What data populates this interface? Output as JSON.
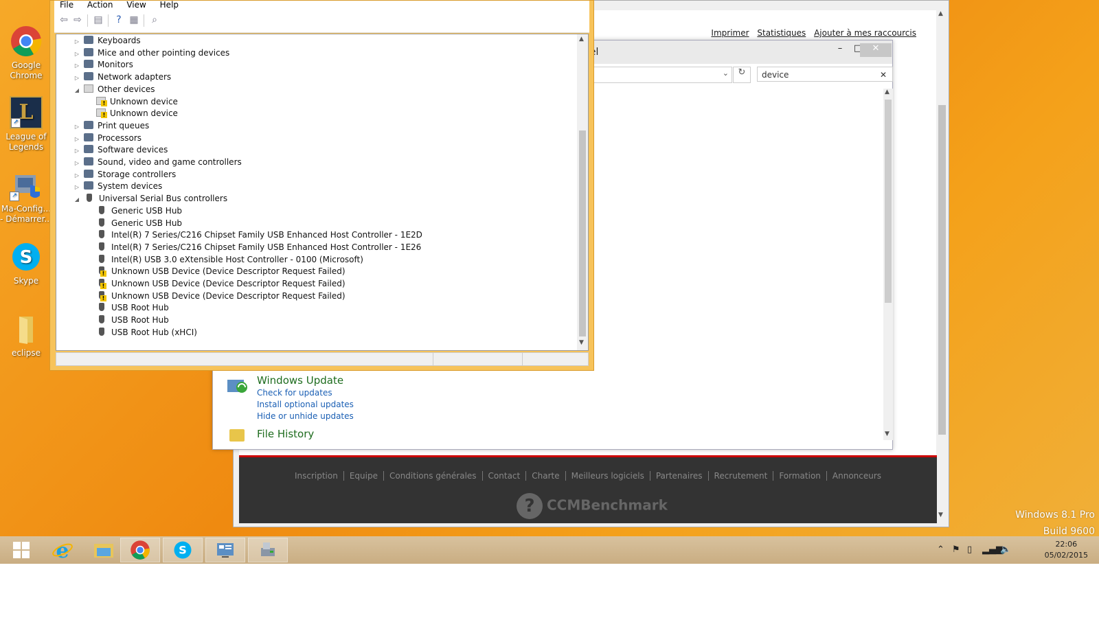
{
  "desktop": {
    "icons": [
      {
        "label": "Google Chrome",
        "icon": "chrome-icon"
      },
      {
        "label": "League of Legends",
        "icon": "league-of-legends-icon"
      },
      {
        "label": "Ma-Config... - Démarrer...",
        "icon": "ma-config-icon"
      },
      {
        "label": "Skype",
        "icon": "skype-icon"
      },
      {
        "label": "eclipse",
        "icon": "folder-icon"
      }
    ],
    "windows_version": "Windows 8.1 Pro",
    "build": "Build 9600"
  },
  "browser": {
    "links": [
      "Imprimer",
      "Statistiques",
      "Ajouter à mes raccourcis"
    ],
    "footer_links": [
      "Inscription",
      "Equipe",
      "Conditions générales",
      "Contact",
      "Charte",
      "Meilleurs logiciels",
      "Partenaires",
      "Recrutement",
      "Formation",
      "Annonceurs"
    ],
    "footer_brand": "CCMBenchmark"
  },
  "control_panel": {
    "title_fragment": "nel",
    "search_value": "device",
    "windows_update": {
      "title": "Windows Update",
      "links": [
        "Check for updates",
        "Install optional updates",
        "Hide or unhide updates"
      ]
    },
    "file_history": "File History"
  },
  "device_manager": {
    "menu": [
      "File",
      "Action",
      "View",
      "Help"
    ],
    "tree": [
      {
        "label": "Keyboards",
        "level": 0,
        "expander": "▷",
        "icon": "keyboard-icon",
        "warn": false
      },
      {
        "label": "Mice and other pointing devices",
        "level": 0,
        "expander": "▷",
        "icon": "mouse-icon",
        "warn": false
      },
      {
        "label": "Monitors",
        "level": 0,
        "expander": "▷",
        "icon": "monitor-icon",
        "warn": false
      },
      {
        "label": "Network adapters",
        "level": 0,
        "expander": "▷",
        "icon": "network-icon",
        "warn": false
      },
      {
        "label": "Other devices",
        "level": 0,
        "expander": "◢",
        "icon": "unknown-category-icon",
        "warn": false
      },
      {
        "label": "Unknown device",
        "level": 1,
        "expander": "",
        "icon": "unknown-device-icon",
        "warn": true
      },
      {
        "label": "Unknown device",
        "level": 1,
        "expander": "",
        "icon": "unknown-device-icon",
        "warn": true
      },
      {
        "label": "Print queues",
        "level": 0,
        "expander": "▷",
        "icon": "printer-icon",
        "warn": false
      },
      {
        "label": "Processors",
        "level": 0,
        "expander": "▷",
        "icon": "processor-icon",
        "warn": false
      },
      {
        "label": "Software devices",
        "level": 0,
        "expander": "▷",
        "icon": "software-device-icon",
        "warn": false
      },
      {
        "label": "Sound, video and game controllers",
        "level": 0,
        "expander": "▷",
        "icon": "speaker-icon",
        "warn": false
      },
      {
        "label": "Storage controllers",
        "level": 0,
        "expander": "▷",
        "icon": "storage-icon",
        "warn": false
      },
      {
        "label": "System devices",
        "level": 0,
        "expander": "▷",
        "icon": "system-device-icon",
        "warn": false
      },
      {
        "label": "Universal Serial Bus controllers",
        "level": 0,
        "expander": "◢",
        "icon": "usb-icon",
        "warn": false
      },
      {
        "label": "Generic USB Hub",
        "level": 1,
        "expander": "",
        "icon": "usb-icon",
        "warn": false
      },
      {
        "label": "Generic USB Hub",
        "level": 1,
        "expander": "",
        "icon": "usb-icon",
        "warn": false
      },
      {
        "label": "Intel(R) 7 Series/C216 Chipset Family USB Enhanced Host Controller - 1E2D",
        "level": 1,
        "expander": "",
        "icon": "usb-icon",
        "warn": false
      },
      {
        "label": "Intel(R) 7 Series/C216 Chipset Family USB Enhanced Host Controller - 1E26",
        "level": 1,
        "expander": "",
        "icon": "usb-icon",
        "warn": false
      },
      {
        "label": "Intel(R) USB 3.0 eXtensible Host Controller - 0100 (Microsoft)",
        "level": 1,
        "expander": "",
        "icon": "usb-icon",
        "warn": false
      },
      {
        "label": "Unknown USB Device (Device Descriptor Request Failed)",
        "level": 1,
        "expander": "",
        "icon": "usb-icon",
        "warn": true
      },
      {
        "label": "Unknown USB Device (Device Descriptor Request Failed)",
        "level": 1,
        "expander": "",
        "icon": "usb-icon",
        "warn": true
      },
      {
        "label": "Unknown USB Device (Device Descriptor Request Failed)",
        "level": 1,
        "expander": "",
        "icon": "usb-icon",
        "warn": true
      },
      {
        "label": "USB Root Hub",
        "level": 1,
        "expander": "",
        "icon": "usb-icon",
        "warn": false
      },
      {
        "label": "USB Root Hub",
        "level": 1,
        "expander": "",
        "icon": "usb-icon",
        "warn": false
      },
      {
        "label": "USB Root Hub (xHCI)",
        "level": 1,
        "expander": "",
        "icon": "usb-icon",
        "warn": false
      }
    ]
  },
  "taskbar": {
    "apps": [
      "start-icon",
      "internet-explorer-icon",
      "file-explorer-icon",
      "chrome-icon",
      "skype-icon",
      "control-panel-icon",
      "device-manager-icon"
    ],
    "time": "22:06",
    "date": "05/02/2015"
  }
}
